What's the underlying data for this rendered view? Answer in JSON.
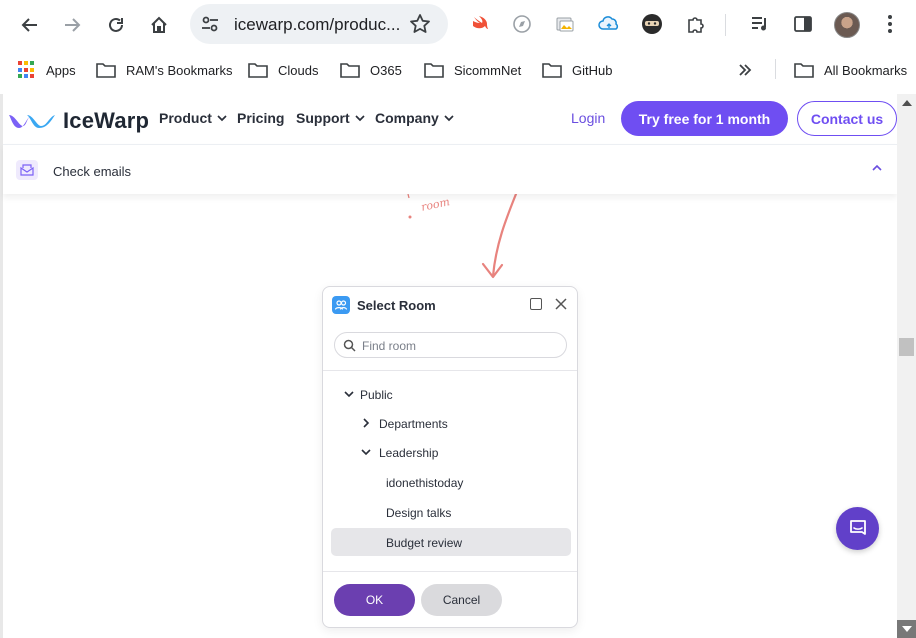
{
  "browser": {
    "url": "icewarp.com/produc...",
    "icons": {
      "back": "back-arrow-icon",
      "forward": "forward-arrow-icon",
      "reload": "reload-icon",
      "home": "home-icon",
      "site_settings": "tune-icon",
      "bookmark": "star-icon",
      "menu": "kebab-menu-icon"
    },
    "extensions": [
      "swift-extension-icon",
      "compass-extension-icon",
      "gallery-extension-icon",
      "cloud-extension-icon",
      "ninja-extension-icon",
      "puzzle-extensions-icon",
      "media-queue-icon",
      "side-panel-icon"
    ]
  },
  "bookmarks": {
    "items": [
      {
        "label": "Apps",
        "icon": "apps-grid-icon"
      },
      {
        "label": "RAM's Bookmarks",
        "icon": "folder-icon"
      },
      {
        "label": "Clouds",
        "icon": "folder-icon"
      },
      {
        "label": "O365",
        "icon": "folder-icon"
      },
      {
        "label": "SicommNet",
        "icon": "folder-icon"
      },
      {
        "label": "GitHub",
        "icon": "folder-icon"
      }
    ],
    "overflow_icon": "double-chevron-icon",
    "all_bookmarks": "All Bookmarks"
  },
  "site": {
    "logo_text": "IceWarp",
    "nav": [
      {
        "label": "Product",
        "dropdown": true
      },
      {
        "label": "Pricing",
        "dropdown": false
      },
      {
        "label": "Support",
        "dropdown": true
      },
      {
        "label": "Company",
        "dropdown": true
      }
    ],
    "login": "Login",
    "try_free": "Try free for 1 month",
    "contact": "Contact us",
    "accent": "#6f4ef2"
  },
  "subbar": {
    "label": "Check emails",
    "icon": "envelope-icon"
  },
  "illustration": {
    "handwritten": "room"
  },
  "dialog": {
    "title": "Select Room",
    "search_placeholder": "Find room",
    "tree": [
      {
        "label": "Public",
        "level": 0,
        "expanded": true,
        "has_children": true
      },
      {
        "label": "Departments",
        "level": 1,
        "expanded": false,
        "has_children": true
      },
      {
        "label": "Leadership",
        "level": 1,
        "expanded": true,
        "has_children": true
      },
      {
        "label": "idonethistoday",
        "level": 2,
        "has_children": false
      },
      {
        "label": "Design talks",
        "level": 2,
        "has_children": false
      },
      {
        "label": "Budget review",
        "level": 2,
        "has_children": false,
        "selected": true
      }
    ],
    "ok": "OK",
    "cancel": "Cancel",
    "ok_color": "#6b3fb0"
  },
  "chat_widget": {
    "icon": "chat-bubble-icon",
    "color": "#6140c9"
  }
}
